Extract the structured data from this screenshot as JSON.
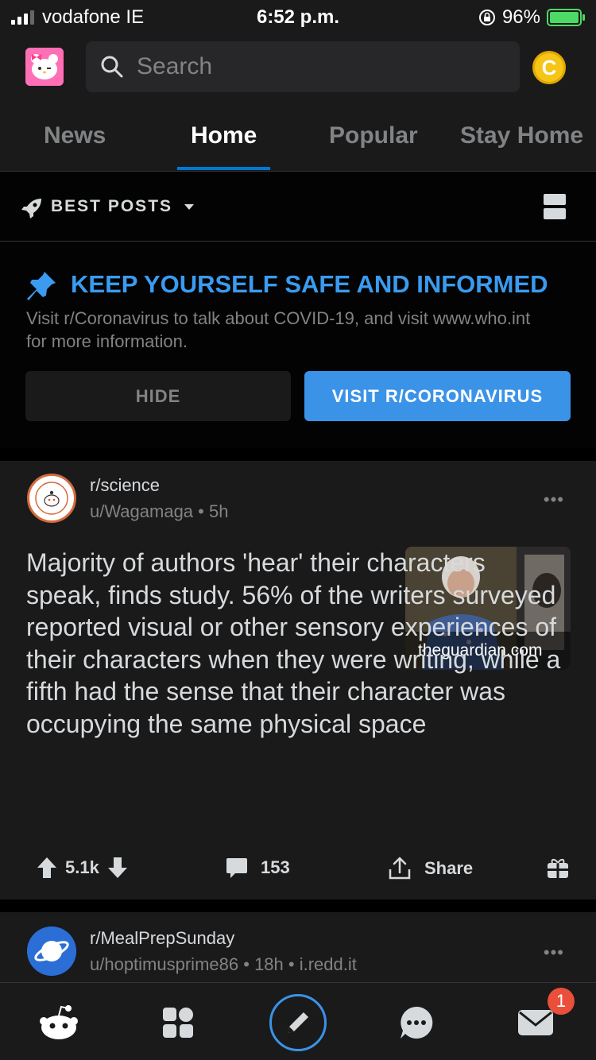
{
  "status_bar": {
    "carrier": "vodafone IE",
    "time": "6:52 p.m.",
    "battery": "96%"
  },
  "search": {
    "placeholder": "Search"
  },
  "tabs": [
    "News",
    "Home",
    "Popular",
    "Stay Home"
  ],
  "sort": {
    "label": "BEST POSTS"
  },
  "announcement": {
    "title": "KEEP YOURSELF SAFE AND INFORMED",
    "description": "Visit r/Coronavirus to talk about COVID-19, and visit www.who.int for more information.",
    "hide_label": "HIDE",
    "visit_label": "VISIT R/CORONAVIRUS"
  },
  "post": {
    "subreddit": "r/science",
    "user": "u/Wagamaga",
    "age": "5h",
    "title": "Majority of authors 'hear' their characters speak, finds study. 56% of the writers surveyed reported visual or other sensory experiences of their characters when they were writing, while a fifth had the sense that their character was occupying the same physical space",
    "domain": "theguardian.com",
    "votes": "5.1k",
    "comments": "153",
    "share_label": "Share"
  },
  "post2": {
    "subreddit": "r/MealPrepSunday",
    "user": "u/hoptimusprime86",
    "age": "18h",
    "domain": "i.redd.it"
  },
  "inbox_badge": "1",
  "colors": {
    "accent": "#0079d3",
    "button_blue": "#3b93e8",
    "background": "#1a1a1b",
    "badge": "#ea4f3c"
  }
}
